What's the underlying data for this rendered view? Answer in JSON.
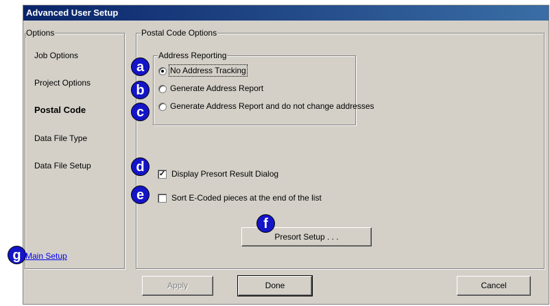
{
  "window": {
    "title": "Advanced User Setup"
  },
  "options": {
    "legend": "Options",
    "items": [
      {
        "label": "Job Options",
        "active": false
      },
      {
        "label": "Project Options",
        "active": false
      },
      {
        "label": "Postal Code",
        "active": true
      },
      {
        "label": "Data File Type",
        "active": false
      },
      {
        "label": "Data File Setup",
        "active": false
      }
    ],
    "main_setup_link": "Main Setup"
  },
  "postal": {
    "legend": "Postal Code Options",
    "address_reporting": {
      "legend": "Address Reporting",
      "radios": [
        {
          "label": "No Address Tracking",
          "checked": true
        },
        {
          "label": "Generate Address Report",
          "checked": false
        },
        {
          "label": "Generate Address Report and do not change addresses",
          "checked": false
        }
      ]
    },
    "display_presort": {
      "label": "Display Presort Result Dialog",
      "checked": true
    },
    "sort_ecoded": {
      "label": "Sort E-Coded pieces at the end of the list",
      "checked": false
    },
    "presort_setup_label": "Presort Setup . . ."
  },
  "buttons": {
    "apply": "Apply",
    "done": "Done",
    "cancel": "Cancel"
  },
  "annotations": [
    "a",
    "b",
    "c",
    "d",
    "e",
    "f",
    "g"
  ],
  "colors": {
    "badge": "#1414c8",
    "title_start": "#0a246a",
    "title_end": "#3a6ea5",
    "link": "#0000ee"
  }
}
